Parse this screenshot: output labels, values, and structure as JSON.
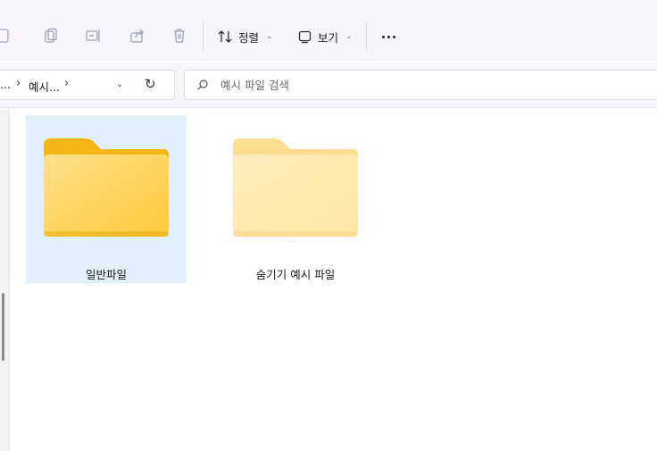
{
  "toolbar": {
    "sort_label": "정렬",
    "view_label": "보기"
  },
  "address": {
    "crumbs": [
      "...",
      "예시..."
    ]
  },
  "search": {
    "placeholder": "예시 파일 검색"
  },
  "files": [
    {
      "name": "일반파일",
      "selected": true,
      "hidden": false
    },
    {
      "name": "숨기기 예시 파일",
      "selected": false,
      "hidden": true
    }
  ],
  "colors": {
    "selection": "#e2f0fc",
    "folder_back": "#f4b400",
    "folder_front": "#ffd766"
  }
}
